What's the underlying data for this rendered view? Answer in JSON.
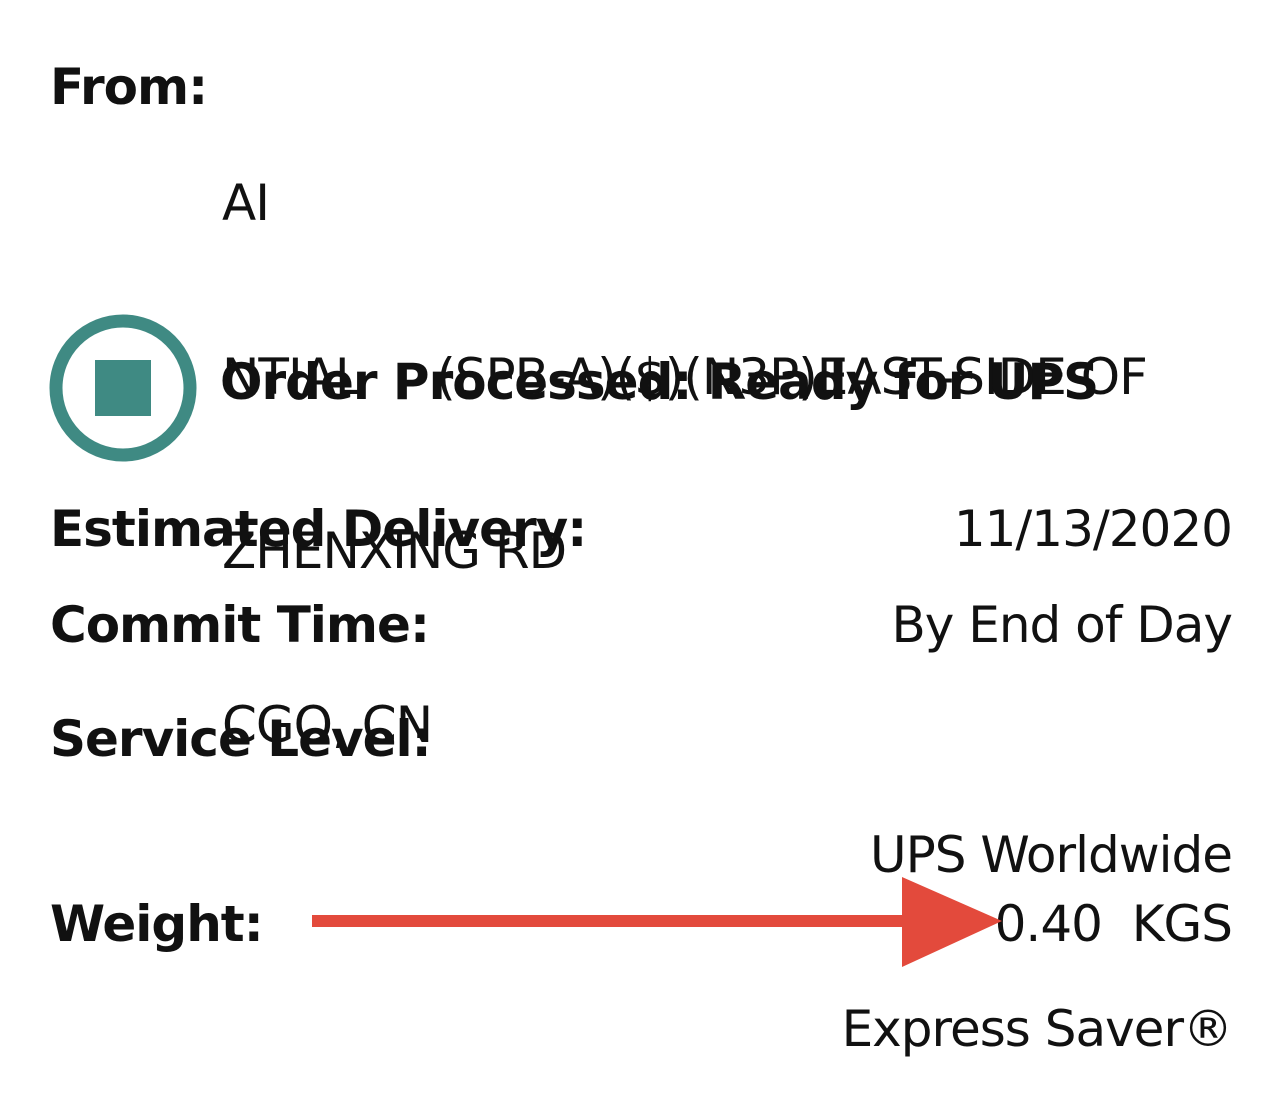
{
  "from": {
    "label": "From:",
    "address_lines": [
      "AI",
      "NTIAL     (SPB-A)($)(N3P)EAST-SIDE OF",
      "ZHENXING RD",
      "CGO, CN"
    ]
  },
  "status": {
    "icon": "stop-square-icon",
    "text": "Order Processed: Ready for UPS",
    "color": "#3f8a83"
  },
  "details": {
    "estimated_delivery": {
      "label": "Estimated Delivery:",
      "value": "11/13/2020"
    },
    "commit_time": {
      "label": "Commit Time:",
      "value": "By End of Day"
    },
    "service_level": {
      "label": "Service Level:",
      "value_lines": [
        "UPS Worldwide",
        "Express Saver®"
      ]
    },
    "weight": {
      "label": "Weight:",
      "value": "0.40  KGS"
    }
  },
  "annotation": {
    "icon": "arrow-right-icon",
    "color": "#e34a3c"
  }
}
